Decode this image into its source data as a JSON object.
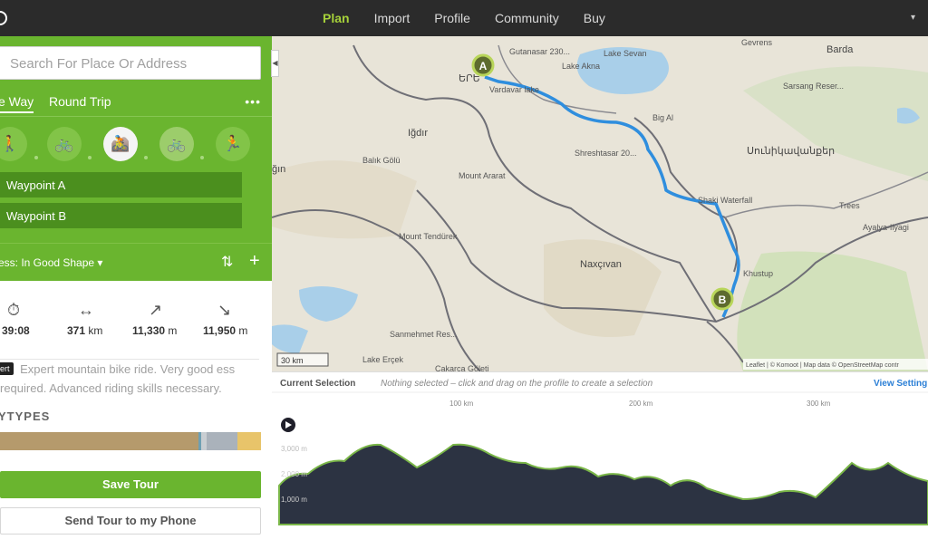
{
  "nav": {
    "items": [
      "Plan",
      "Import",
      "Profile",
      "Community",
      "Buy"
    ],
    "active": "Plan"
  },
  "search": {
    "placeholder": "Search For Place Or Address"
  },
  "route_modes": {
    "one_way": "e Way",
    "round_trip": "Round Trip",
    "more": "•••"
  },
  "sports": [
    "hiking",
    "road-cycling",
    "mountain-biking",
    "touring-bike",
    "running"
  ],
  "waypoints": [
    "Waypoint A",
    "Waypoint B"
  ],
  "fitness": {
    "label": "ess: In Good Shape ▾"
  },
  "stats": {
    "duration": "39:08",
    "distance": "371",
    "distance_unit": "km",
    "uphill": "11,330",
    "uphill_unit": "m",
    "downhill": "11,950",
    "downhill_unit": "m"
  },
  "difficulty": {
    "badge": "ert",
    "text": "Expert mountain bike ride. Very good ess required. Advanced riding skills necessary."
  },
  "waytypes": {
    "title": "YTYPES",
    "segments": [
      {
        "color": "#b59a6c",
        "pct": 76
      },
      {
        "color": "#6e9fb2",
        "pct": 1
      },
      {
        "color": "#c9ced2",
        "pct": 2
      },
      {
        "color": "#aab2bb",
        "pct": 12
      },
      {
        "color": "#e8c46a",
        "pct": 9
      }
    ]
  },
  "buttons": {
    "save": "Save Tour",
    "phone": "Send Tour to my Phone"
  },
  "map": {
    "places": [
      "Gutanasar 230...",
      "Lake Sevan",
      "Lake Akna",
      "Vardavar lake",
      "Big Al",
      "Shreshtasar 20...",
      "Sarsang Reser...",
      "Shaki Waterfall",
      "Iğdır",
      "Balık Gölü",
      "Mount Ararat",
      "Mount Tendürek",
      "Naxçıvan",
      "Khustup",
      "Sanmehmet Res...",
      "Lake Erçek",
      "Trees",
      "Ayalya-Ilyagi",
      "Barda",
      "Gevrens",
      "Սունիկավանքեր",
      "ğın",
      "Çakarca Göleti",
      "ԵՐԵ"
    ],
    "marker_a": "A",
    "marker_b": "B",
    "scale": "30 km",
    "attribution": "Leaflet | © Komoot | Map data © OpenStreetMap contr"
  },
  "profile": {
    "current_selection": "Current Selection",
    "hint": "Nothing selected – click and drag on the profile to create a selection",
    "view_settings": "View Setting",
    "x_ticks": [
      "100 km",
      "200 km",
      "300 km"
    ],
    "y_ticks": [
      "3,000 m",
      "2,000 m",
      "1,000 m"
    ]
  },
  "colors": {
    "accent": "#6ab52f",
    "route": "#2f8ede"
  }
}
